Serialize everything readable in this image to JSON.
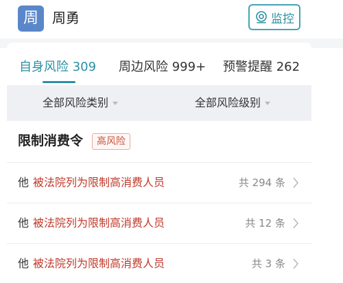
{
  "header": {
    "avatar_char": "周",
    "name": "周勇",
    "monitor_button": "监控"
  },
  "tabs": [
    {
      "label": "自身风险 309",
      "active": true
    },
    {
      "label": "周边风险 999+",
      "active": false
    },
    {
      "label": "预警提醒 262",
      "active": false
    }
  ],
  "filters": {
    "risk_type": "全部风险类别",
    "risk_level": "全部风险级别"
  },
  "section": {
    "title": "限制消费令",
    "badge": "高风险"
  },
  "rows": [
    {
      "subject": "他",
      "desc": "被法院列为限制高消费人员",
      "count": "共 294 条"
    },
    {
      "subject": "他",
      "desc": "被法院列为限制高消费人员",
      "count": "共 12 条"
    },
    {
      "subject": "他",
      "desc": "被法院列为限制高消费人员",
      "count": "共 3 条"
    }
  ],
  "colors": {
    "accent": "#2a8fa3",
    "avatar_bg": "#5a87c9",
    "risk_red": "#c0392b"
  }
}
